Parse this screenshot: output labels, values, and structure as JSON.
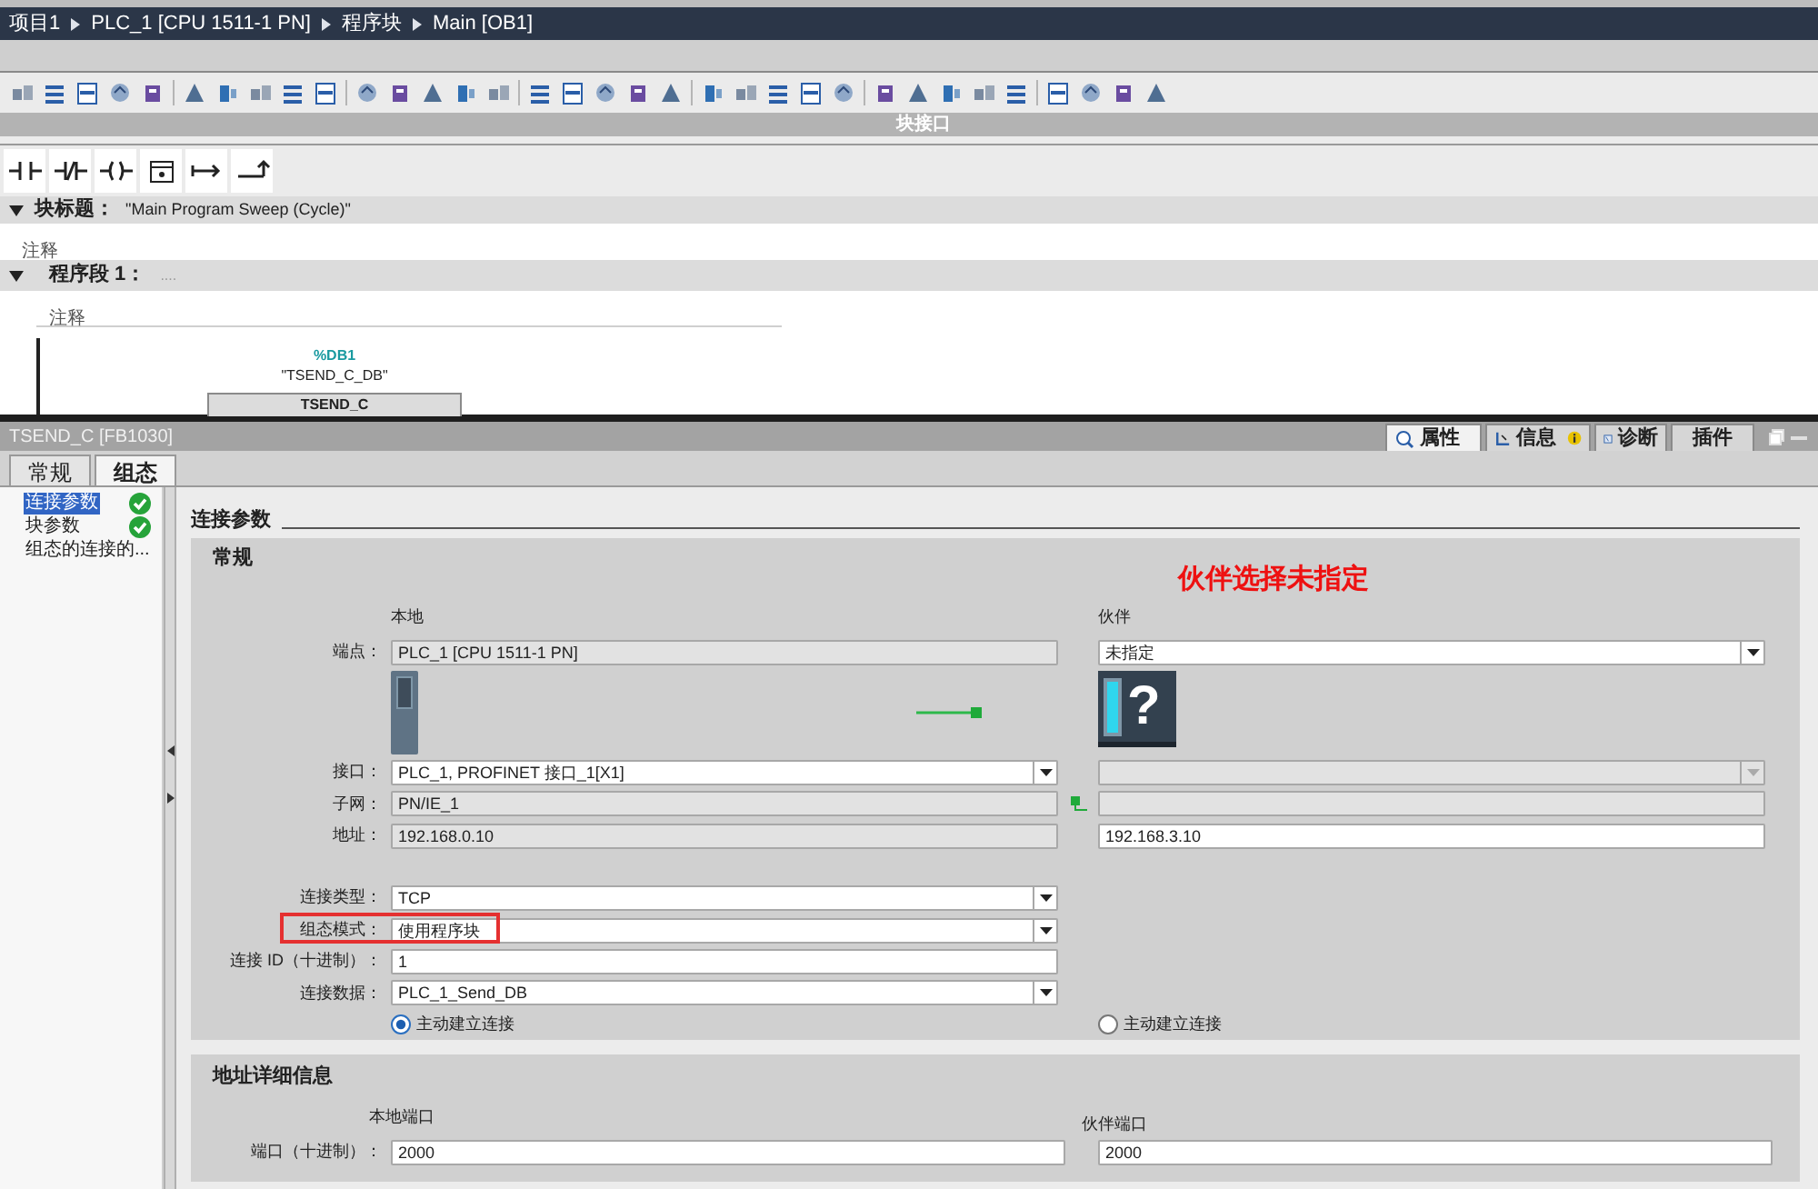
{
  "breadcrumb": [
    "项目1",
    "PLC_1 [CPU 1511-1 PN]",
    "程序块",
    "Main [OB1]"
  ],
  "interface_bar": {
    "label": "块接口"
  },
  "block_title": {
    "label": "块标题：",
    "value": "\"Main Program Sweep (Cycle)\"",
    "expanded": true,
    "comment": "注释"
  },
  "network": {
    "label": "程序段 1：",
    "title": "....",
    "expanded": true,
    "comment": "注释",
    "instance": "%DB1",
    "instance_name": "\"TSEND_C_DB\"",
    "block": "TSEND_C"
  },
  "inspector": {
    "title": "TSEND_C [FB1030]",
    "tabs": [
      {
        "label": "属性",
        "kind": "properties",
        "selected": true
      },
      {
        "label": "信息",
        "kind": "info",
        "selected": false
      },
      {
        "label": "诊断",
        "kind": "diagnostics",
        "selected": false
      },
      {
        "label": "插件",
        "kind": "plain",
        "selected": false
      }
    ],
    "sub_tabs": [
      {
        "label": "常规",
        "selected": false
      },
      {
        "label": "组态",
        "selected": true
      }
    ],
    "nav": [
      {
        "label": "连接参数",
        "selected": true,
        "valid": true
      },
      {
        "label": "块参数",
        "selected": false,
        "valid": true
      },
      {
        "label": "组态的连接的...",
        "selected": false,
        "valid": false
      }
    ],
    "section_title": "连接参数",
    "general": {
      "title": "常规",
      "local_heading": "本地",
      "partner_heading": "伙伴",
      "annotation": "伙伴选择未指定",
      "partner_device_glyph": "?",
      "endpoint": {
        "label": "端点：",
        "local": {
          "kind": "readonly",
          "value": "PLC_1 [CPU 1511-1 PN]"
        },
        "partner": {
          "kind": "dropdown",
          "value": "未指定"
        }
      },
      "network_rows": [
        {
          "label": "接口：",
          "local": {
            "kind": "dropdown",
            "value": "PLC_1, PROFINET 接口_1[X1]"
          },
          "partner": {
            "kind": "dropdown",
            "disabled": true
          }
        },
        {
          "label": "子网：",
          "local": {
            "kind": "readonly",
            "value": "PN/IE_1"
          },
          "partner": {
            "kind": "readonly"
          },
          "port_icon": true
        },
        {
          "label": "地址：",
          "local": {
            "kind": "readonly",
            "value": "192.168.0.10"
          },
          "partner": {
            "kind": "input",
            "value": "192.168.3.10"
          }
        }
      ],
      "connection_rows": [
        {
          "label": "连接类型：",
          "local": {
            "kind": "dropdown",
            "value": "TCP"
          },
          "highlighted": false
        },
        {
          "label": "组态模式：",
          "local": {
            "kind": "dropdown",
            "value": "使用程序块"
          },
          "highlighted": true
        },
        {
          "label": "连接 ID（十进制）：",
          "local": {
            "kind": "input",
            "value": "1"
          },
          "highlighted": false
        },
        {
          "label": "连接数据：",
          "local": {
            "kind": "dropdown",
            "value": "PLC_1_Send_DB"
          },
          "highlighted": false
        }
      ],
      "active_connection": {
        "local": {
          "label": "主动建立连接",
          "selected": true
        },
        "partner": {
          "label": "主动建立连接",
          "selected": false
        }
      }
    },
    "address_details": {
      "title": "地址详细信息",
      "local_heading": "本地端口",
      "partner_heading": "伙伴端口",
      "label": "端口（十进制）：",
      "local": "2000",
      "partner": "2000"
    }
  }
}
